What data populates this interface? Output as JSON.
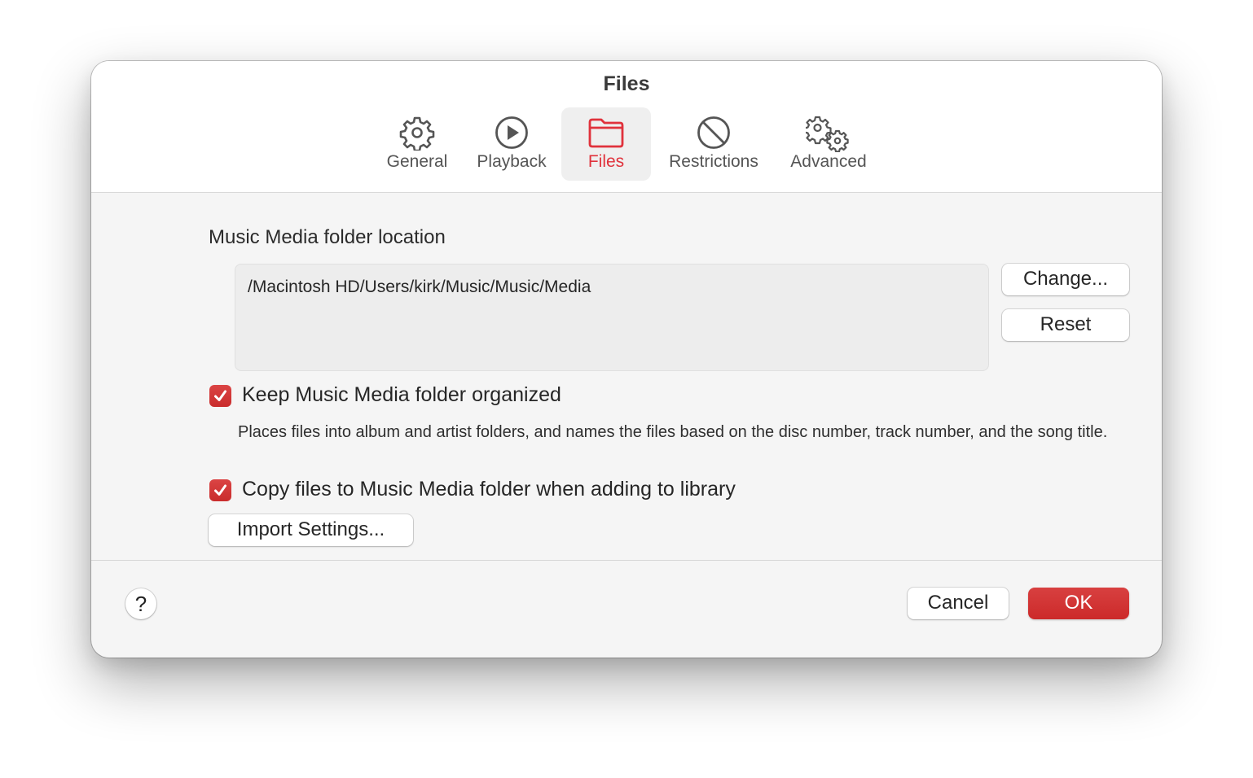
{
  "window": {
    "title": "Files"
  },
  "tabs": [
    {
      "label": "General",
      "icon": "gear-icon",
      "selected": false
    },
    {
      "label": "Playback",
      "icon": "play-circle-icon",
      "selected": false
    },
    {
      "label": "Files",
      "icon": "folder-icon",
      "selected": true
    },
    {
      "label": "Restrictions",
      "icon": "prohibited-icon",
      "selected": false
    },
    {
      "label": "Advanced",
      "icon": "gears-icon",
      "selected": false
    }
  ],
  "media_folder": {
    "label": "Music Media folder location",
    "path": "/Macintosh HD/Users/kirk/Music/Music/Media",
    "change_label": "Change...",
    "reset_label": "Reset"
  },
  "options": {
    "keep_organized": {
      "label": "Keep Music Media folder organized",
      "checked": true,
      "description": "Places files into album and artist folders, and names the files based on the disc number, track number, and the song title."
    },
    "copy_files": {
      "label": "Copy files to Music Media folder when adding to library",
      "checked": true
    },
    "import_settings_label": "Import Settings..."
  },
  "footer": {
    "help_label": "?",
    "cancel_label": "Cancel",
    "ok_label": "OK"
  },
  "colors": {
    "accent": "#e0323c",
    "ok_button": "#d23333",
    "body_bg": "#f5f5f5",
    "header_bg": "#ffffff"
  }
}
